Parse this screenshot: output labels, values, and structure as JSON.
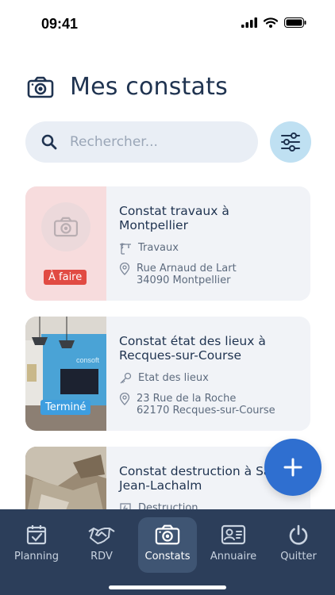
{
  "status": {
    "time": "09:41"
  },
  "header": {
    "title": "Mes constats"
  },
  "search": {
    "placeholder": "Rechercher..."
  },
  "cards": [
    {
      "title": "Constat travaux à Montpellier",
      "category": "Travaux",
      "address_line1": "Rue Arnaud de Lart",
      "address_line2": "34090 Montpellier",
      "status": "À faire",
      "status_color": "#e14b43"
    },
    {
      "title": "Constat état des lieux à Recques-sur-Course",
      "category": "Etat des lieux",
      "address_line1": "23 Rue de la Roche",
      "address_line2": "62170 Recques-sur-Course",
      "status": "Terminé",
      "status_color": "#3d9ee0"
    },
    {
      "title": "Constat destruction à Saint-Jean-Lachalm",
      "category": "Destruction"
    }
  ],
  "nav": {
    "items": [
      {
        "label": "Planning",
        "icon": "calendar-check-icon"
      },
      {
        "label": "RDV",
        "icon": "handshake-icon"
      },
      {
        "label": "Constats",
        "icon": "camera-icon",
        "active": true
      },
      {
        "label": "Annuaire",
        "icon": "contact-card-icon"
      },
      {
        "label": "Quitter",
        "icon": "power-icon"
      }
    ]
  },
  "colors": {
    "accent": "#2f6fd0",
    "nav_bg": "#2c3e5a",
    "todo_card_bg": "#f7dcdd"
  }
}
